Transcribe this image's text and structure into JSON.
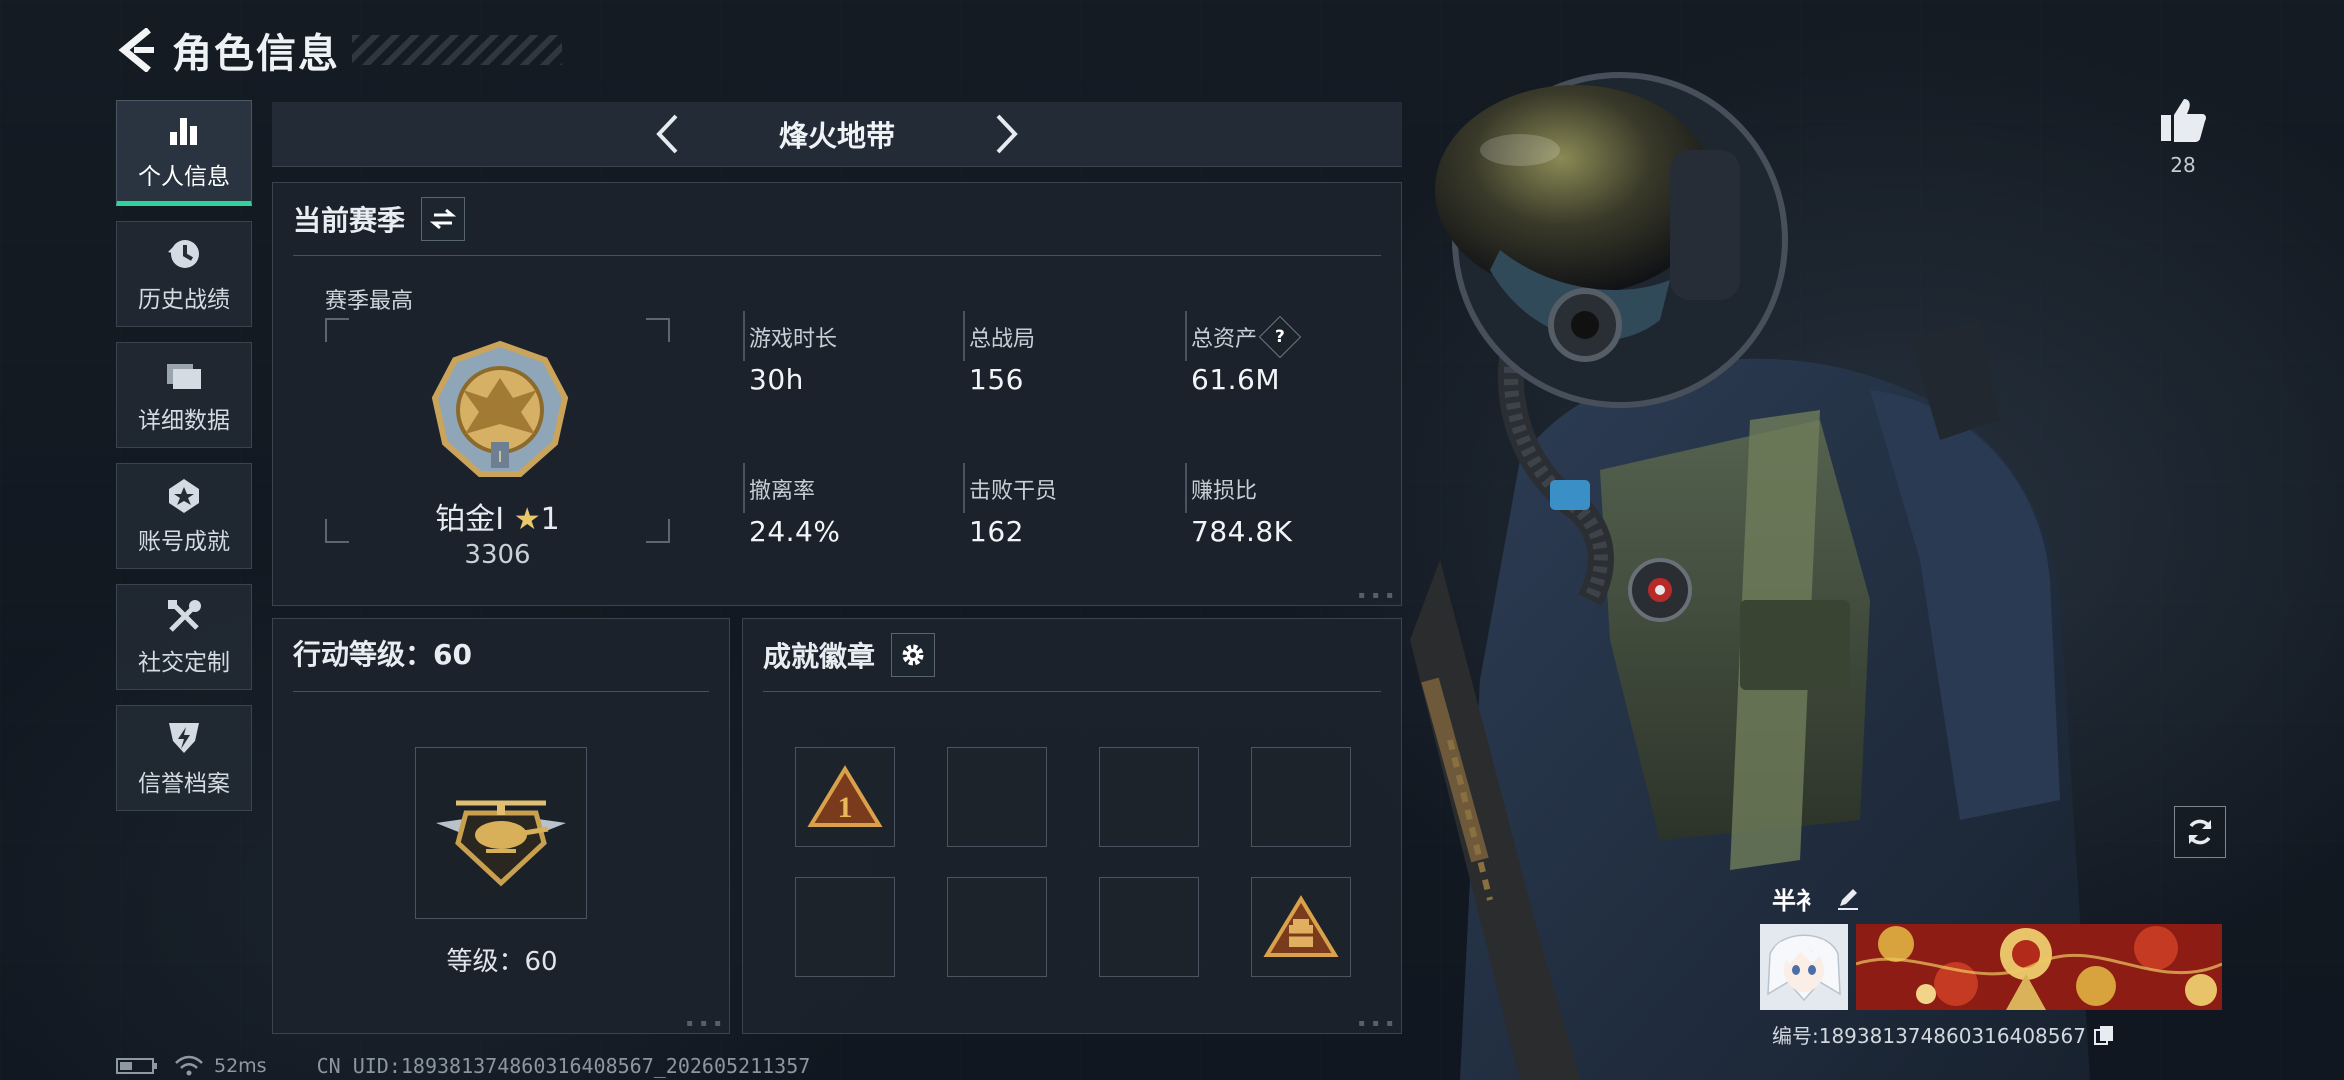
{
  "header": {
    "title": "角色信息"
  },
  "sidebar": {
    "items": [
      {
        "label": "个人信息",
        "icon": "bar-chart-icon",
        "active": true
      },
      {
        "label": "历史战绩",
        "icon": "history-clock-icon",
        "active": false
      },
      {
        "label": "详细数据",
        "icon": "folder-icon",
        "active": false
      },
      {
        "label": "账号成就",
        "icon": "medal-icon",
        "active": false
      },
      {
        "label": "社交定制",
        "icon": "tools-icon",
        "active": false
      },
      {
        "label": "信誉档案",
        "icon": "shield-lightning-icon",
        "active": false
      }
    ]
  },
  "mode": {
    "name": "烽火地带"
  },
  "season": {
    "title": "当前赛季",
    "best_label": "赛季最高",
    "rank_name": "铂金Ⅰ",
    "rank_stars": "1",
    "rank_score": "3306",
    "stats": {
      "play_time": {
        "label": "游戏时长",
        "value": "30h"
      },
      "total_matches": {
        "label": "总战局",
        "value": "156"
      },
      "total_assets": {
        "label": "总资产",
        "value": "61.6M"
      },
      "extract_rate": {
        "label": "撤离率",
        "value": "24.4%"
      },
      "operators_defeated": {
        "label": "击败干员",
        "value": "162"
      },
      "profit_ratio": {
        "label": "赚损比",
        "value": "784.8K"
      }
    },
    "help_glyph": "?"
  },
  "level": {
    "title": "行动等级：60",
    "level_text": "等级：60"
  },
  "achievements": {
    "title": "成就徽章"
  },
  "likes": {
    "count": "28"
  },
  "profile": {
    "name": "半衤",
    "id_text": "编号:18938137486031640856​7"
  },
  "status": {
    "ping": "52ms",
    "uid": "CN UID:18938137486031640856​7_202605211357"
  },
  "colors": {
    "accent": "#2fd39c",
    "gold": "#c89a3e",
    "background": "#141a22"
  }
}
